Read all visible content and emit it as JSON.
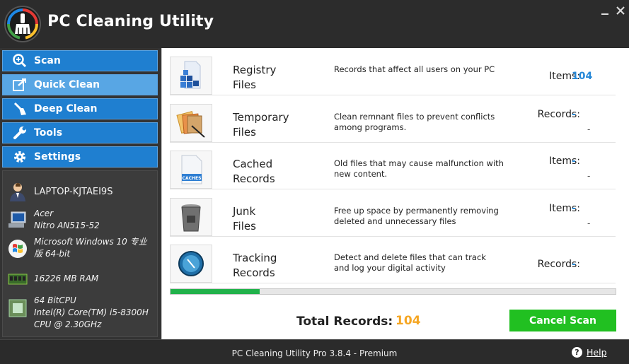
{
  "app": {
    "title": "PC Cleaning Utility"
  },
  "window": {
    "minimize": "—",
    "close": "✕"
  },
  "nav": {
    "scan": "Scan",
    "quick_clean": "Quick Clean",
    "deep_clean": "Deep Clean",
    "tools": "Tools",
    "settings": "Settings"
  },
  "system": {
    "hostname": "LAPTOP-KJTAEI9S",
    "model_line1": "Acer",
    "model_line2": "Nitro AN515-52",
    "os_line1": "Microsoft Windows 10 专业",
    "os_line2": "版 64-bit",
    "ram": "16226 MB RAM",
    "cpu_line1": "64 BitCPU",
    "cpu_line2": "Intel(R) Core(TM) i5-8300H",
    "cpu_line3": "CPU @ 2.30GHz"
  },
  "rows": [
    {
      "title1": "Registry",
      "title2": "Files",
      "desc": "Records that affect all users on your PC",
      "label": "Items:",
      "value": "104",
      "dash": ""
    },
    {
      "title1": "Temporary",
      "title2": "Files",
      "desc": "Clean remnant files to prevent conflicts among programs.",
      "label": "Records:",
      "value": "-",
      "dash": "-"
    },
    {
      "title1": "Cached",
      "title2": "Records",
      "desc": "Old files that may cause malfunction with new content.",
      "label": "Items:",
      "value": "-",
      "dash": "-",
      "icon_text": "CACHES"
    },
    {
      "title1": "Junk",
      "title2": "Files",
      "desc": "Free up space by permanently removing deleted and unnecessary files",
      "label": "Items:",
      "value": "-",
      "dash": "-"
    },
    {
      "title1": "Tracking",
      "title2": "Records",
      "desc": "Detect and delete files that can track and log your digital activity",
      "label": "Records:",
      "value": "-",
      "dash": ""
    }
  ],
  "progress": {
    "fraction": 0.2
  },
  "totals": {
    "label": "Total Records:",
    "value": "104"
  },
  "actions": {
    "cancel_scan": "Cancel Scan"
  },
  "footer": {
    "version": "PC Cleaning Utility Pro 3.8.4 - Premium",
    "help_icon": "?",
    "help": "Help"
  },
  "colors": {
    "nav_blue": "#1f7fd0",
    "nav_active": "#58a6e4",
    "value_blue": "#2688d8",
    "total_orange": "#f5a623",
    "cancel_green": "#21c021",
    "progress_green": "#21b24b"
  }
}
